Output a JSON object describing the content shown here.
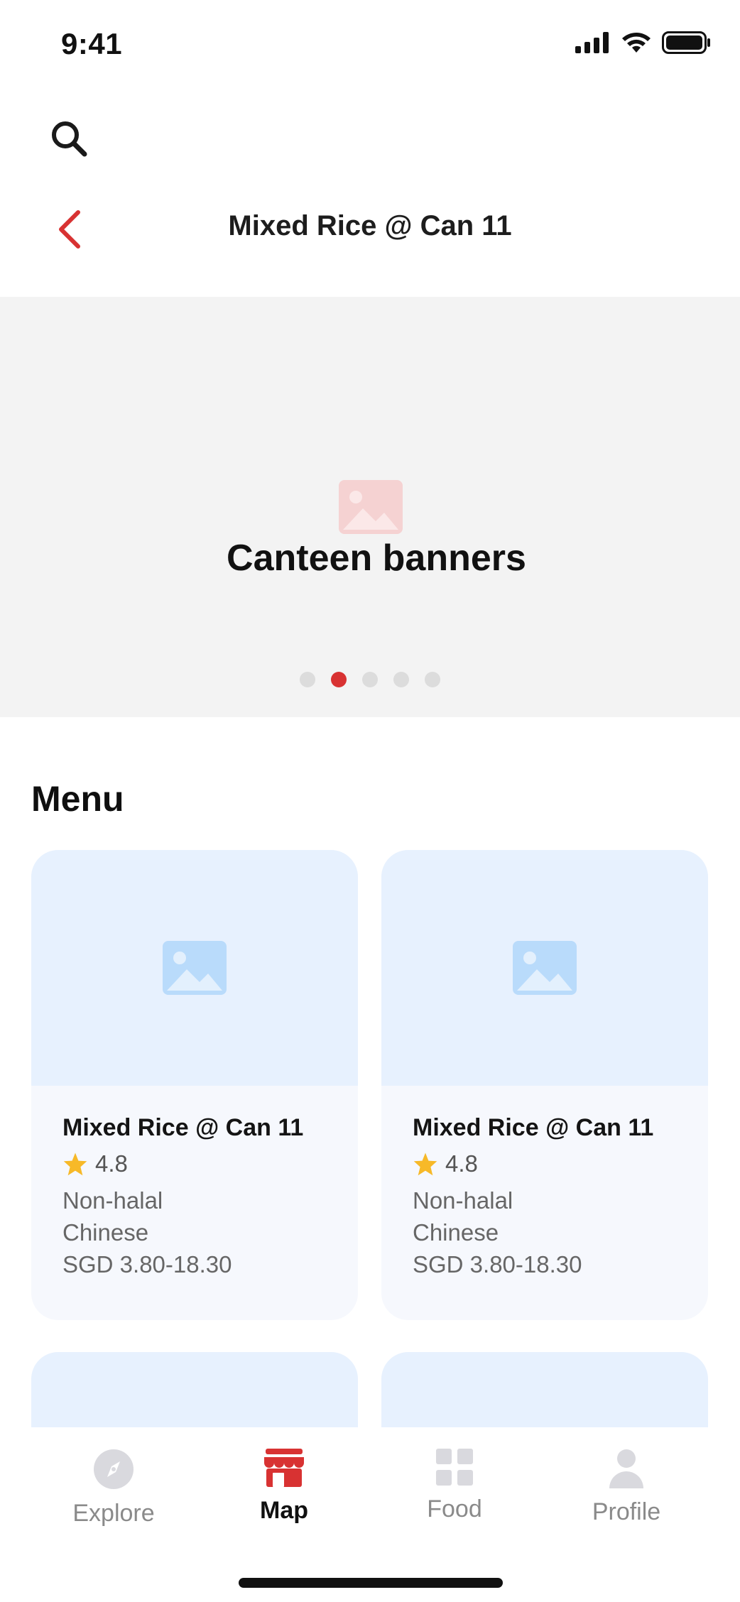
{
  "status_bar": {
    "time": "9:41"
  },
  "header": {
    "title": "Mixed Rice @ Can 11"
  },
  "banner": {
    "text": "Canteen banners",
    "dots_total": 5,
    "active_dot_index": 1,
    "accent_color": "#d83232"
  },
  "menu": {
    "heading": "Menu",
    "items": [
      {
        "title": "Mixed Rice @ Can 11",
        "rating": "4.8",
        "halal": "Non-halal",
        "cuisine": "Chinese",
        "price": "SGD 3.80-18.30"
      },
      {
        "title": "Mixed Rice @ Can 11",
        "rating": "4.8",
        "halal": "Non-halal",
        "cuisine": "Chinese",
        "price": "SGD 3.80-18.30"
      }
    ]
  },
  "bottom_nav": {
    "items": [
      {
        "label": "Explore",
        "icon": "compass-icon",
        "active": false
      },
      {
        "label": "Map",
        "icon": "storefront-icon",
        "active": true
      },
      {
        "label": "Food",
        "icon": "grid-icon",
        "active": false
      },
      {
        "label": "Profile",
        "icon": "user-icon",
        "active": false
      }
    ]
  },
  "colors": {
    "accent": "#d83232",
    "card_image_bg": "#e7f1fe",
    "card_body_bg": "#f6f8fd",
    "star": "#f7b928"
  }
}
